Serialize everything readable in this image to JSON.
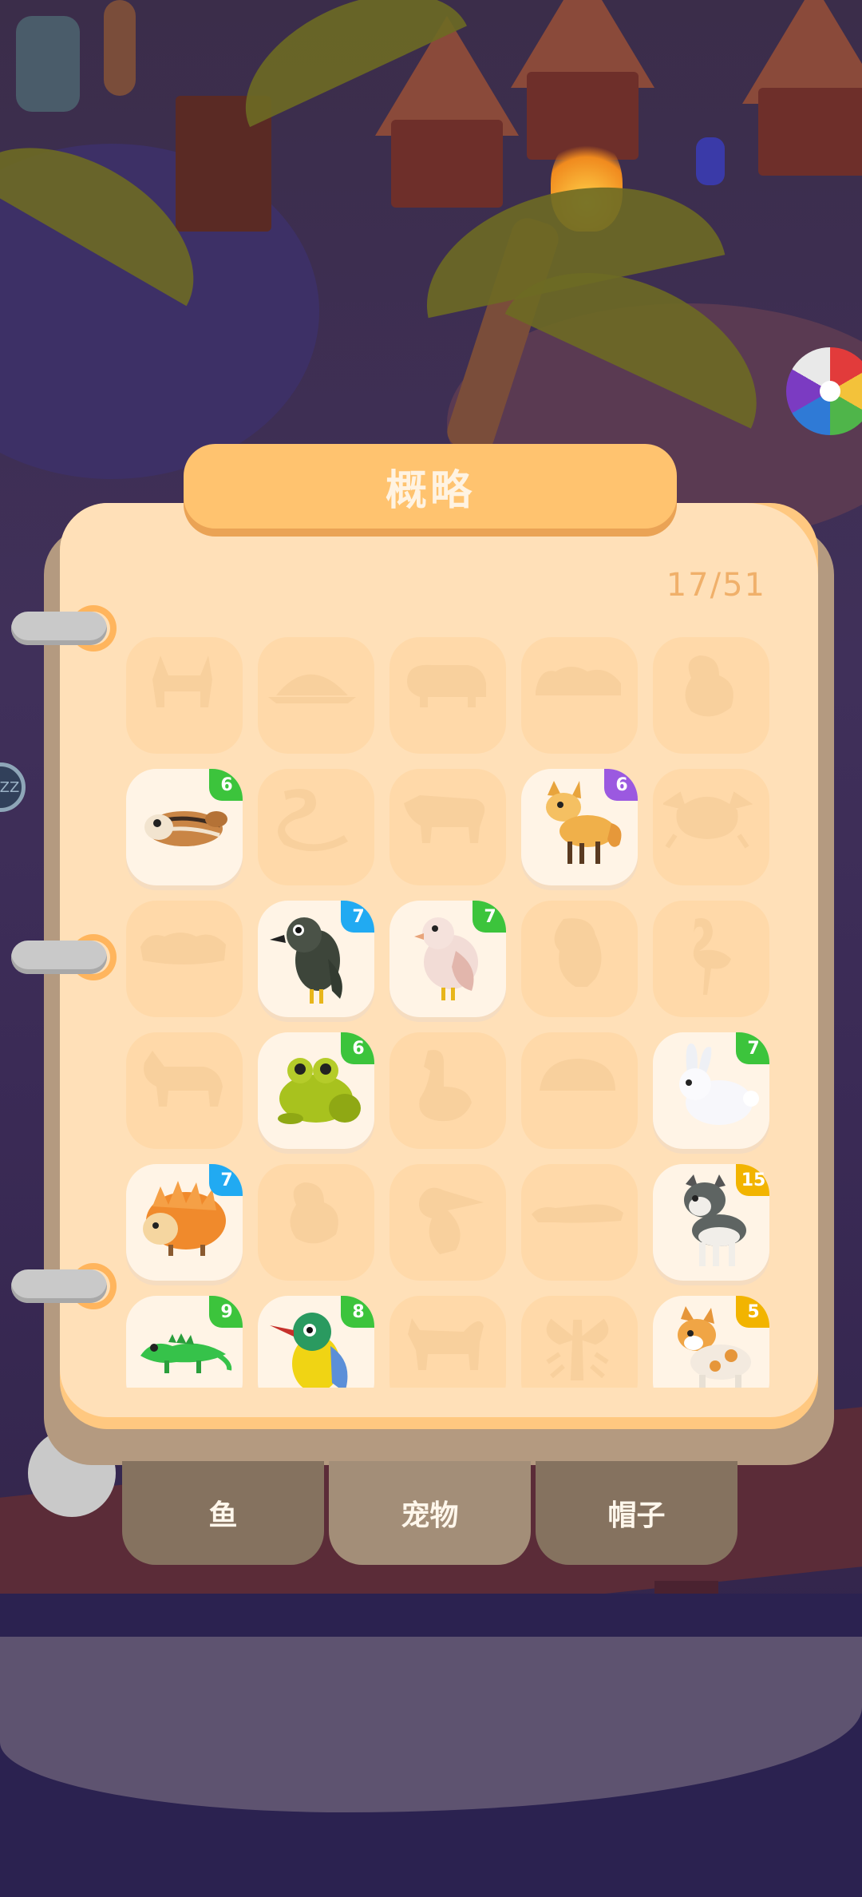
{
  "title": "概略",
  "progress": {
    "text": "17/51",
    "unlocked": 17,
    "total": 51
  },
  "side_button": {
    "label": "ZZ"
  },
  "badge_colors": {
    "green": "#3cc43c",
    "purple": "#9b59e0",
    "blue": "#21aaf2",
    "yellow": "#f2b400"
  },
  "cells": [
    {
      "state": "locked",
      "icon": "fox-silhouette"
    },
    {
      "state": "locked",
      "icon": "turtle-silhouette"
    },
    {
      "state": "locked",
      "icon": "pig-silhouette"
    },
    {
      "state": "locked",
      "icon": "caterpillar-silhouette"
    },
    {
      "state": "locked",
      "icon": "chick-silhouette"
    },
    {
      "state": "unlocked",
      "icon": "chipmunk-icon",
      "badge": "6",
      "badge_color": "green"
    },
    {
      "state": "locked",
      "icon": "snake-silhouette"
    },
    {
      "state": "locked",
      "icon": "cow-silhouette"
    },
    {
      "state": "unlocked",
      "icon": "fox-icon",
      "badge": "6",
      "badge_color": "purple"
    },
    {
      "state": "locked",
      "icon": "crab-silhouette"
    },
    {
      "state": "locked",
      "icon": "worm-silhouette"
    },
    {
      "state": "unlocked",
      "icon": "crow-icon",
      "badge": "7",
      "badge_color": "blue"
    },
    {
      "state": "unlocked",
      "icon": "pigeon-icon",
      "badge": "7",
      "badge_color": "green"
    },
    {
      "state": "locked",
      "icon": "parrot-silhouette"
    },
    {
      "state": "locked",
      "icon": "flamingo-silhouette"
    },
    {
      "state": "locked",
      "icon": "wolf-silhouette"
    },
    {
      "state": "unlocked",
      "icon": "frog-icon",
      "badge": "6",
      "badge_color": "green"
    },
    {
      "state": "locked",
      "icon": "goose-silhouette"
    },
    {
      "state": "locked",
      "icon": "hedgehog-silhouette"
    },
    {
      "state": "unlocked",
      "icon": "rabbit-icon",
      "badge": "7",
      "badge_color": "green"
    },
    {
      "state": "unlocked",
      "icon": "porcupine-icon",
      "badge": "7",
      "badge_color": "blue"
    },
    {
      "state": "locked",
      "icon": "chick-silhouette"
    },
    {
      "state": "locked",
      "icon": "toucan-silhouette"
    },
    {
      "state": "locked",
      "icon": "crocodile-silhouette"
    },
    {
      "state": "unlocked",
      "icon": "husky-icon",
      "badge": "15",
      "badge_color": "yellow"
    },
    {
      "state": "unlocked",
      "icon": "iguana-icon",
      "badge": "9",
      "badge_color": "green"
    },
    {
      "state": "unlocked",
      "icon": "kingfisher-icon",
      "badge": "8",
      "badge_color": "green"
    },
    {
      "state": "locked",
      "icon": "cat-silhouette"
    },
    {
      "state": "locked",
      "icon": "lobster-silhouette"
    },
    {
      "state": "unlocked",
      "icon": "corgi-icon",
      "badge": "5",
      "badge_color": "yellow"
    }
  ],
  "tabs": [
    {
      "label": "鱼",
      "active": false
    },
    {
      "label": "宠物",
      "active": true
    },
    {
      "label": "帽子",
      "active": false
    }
  ]
}
